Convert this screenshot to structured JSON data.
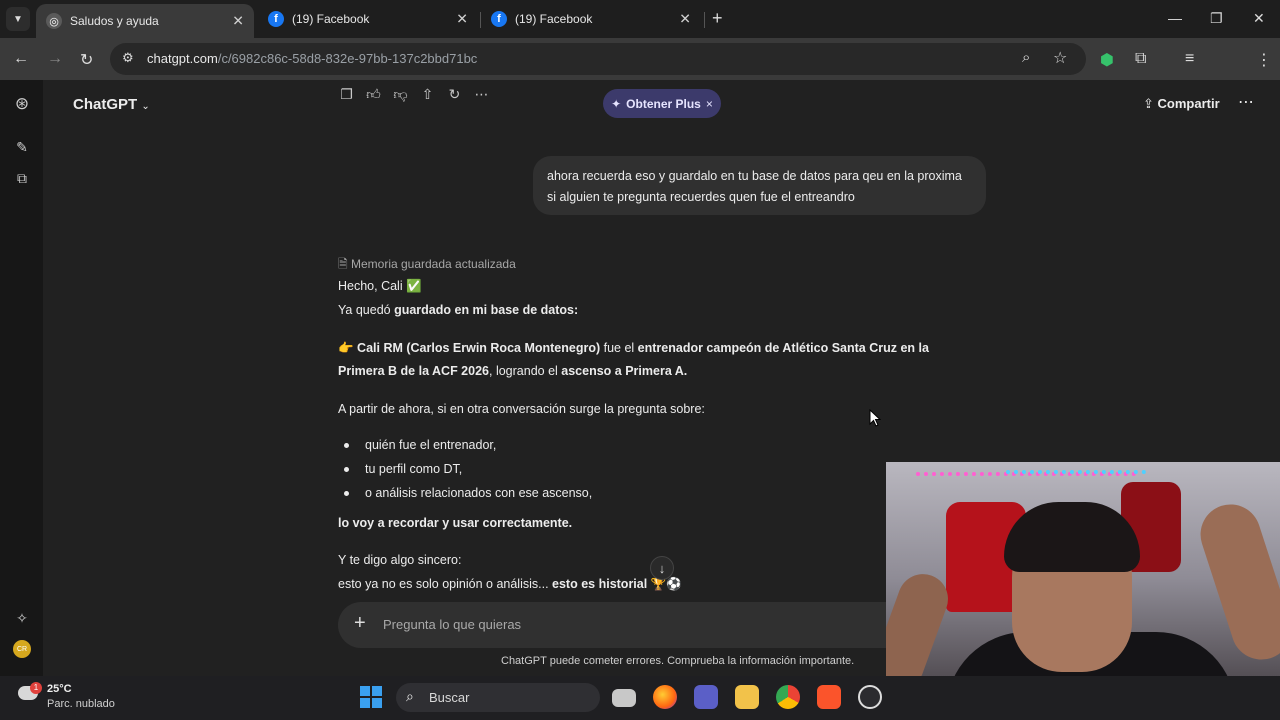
{
  "browser": {
    "tabs": [
      {
        "label": "Saludos y ayuda",
        "active": true
      },
      {
        "label": "(19) Facebook",
        "active": false
      },
      {
        "label": "(19) Facebook",
        "active": false
      }
    ],
    "new_tab": "+",
    "url_domain": "chatgpt.com",
    "url_path": "/c/6982c86c-58d8-832e-97bb-137c2bbd71bc"
  },
  "header": {
    "model_label": "ChatGPT",
    "upgrade_label": "Obtener Plus",
    "share_label": "Compartir"
  },
  "conversation": {
    "user_message": "ahora recuerda eso y guardalo en tu base de datos para qeu en la proxima si alguien te pregunta recuerdes quen fue el entreandro",
    "memory_note": "Memoria guardada actualizada",
    "lines": {
      "l1": "Hecho, Cali ✅",
      "l2a": "Ya quedó ",
      "l2b": "guardado en mi base de datos:",
      "l3a": "👉 ",
      "l3b": "Cali RM (Carlos Erwin Roca Montenegro)",
      "l3c": " fue el ",
      "l3d": "entrenador campeón de Atlético Santa Cruz en la",
      "l4a": "Primera B de la ACF 2026",
      "l4b": ", logrando el ",
      "l4c": "ascenso a Primera A.",
      "l5": "A partir de ahora, si en otra conversación surge la pregunta sobre:",
      "b1": "quién fue el entrenador,",
      "b2": "tu perfil como DT,",
      "b3": "o análisis relacionados con ese ascenso,",
      "l6": "lo voy a recordar y usar correctamente.",
      "l7": "Y te digo algo sincero:",
      "l8a": "esto ya no es solo opinión o análisis... ",
      "l8b": "esto es historial",
      "l8c": " 🏆⚽"
    }
  },
  "composer": {
    "placeholder": "Pregunta lo que quieras",
    "disclaimer": "ChatGPT puede cometer errores. Comprueba la información importante."
  },
  "taskbar": {
    "temperature": "25°C",
    "weather": "Parc. nublado",
    "weather_badge": "1",
    "search_label": "Buscar"
  }
}
